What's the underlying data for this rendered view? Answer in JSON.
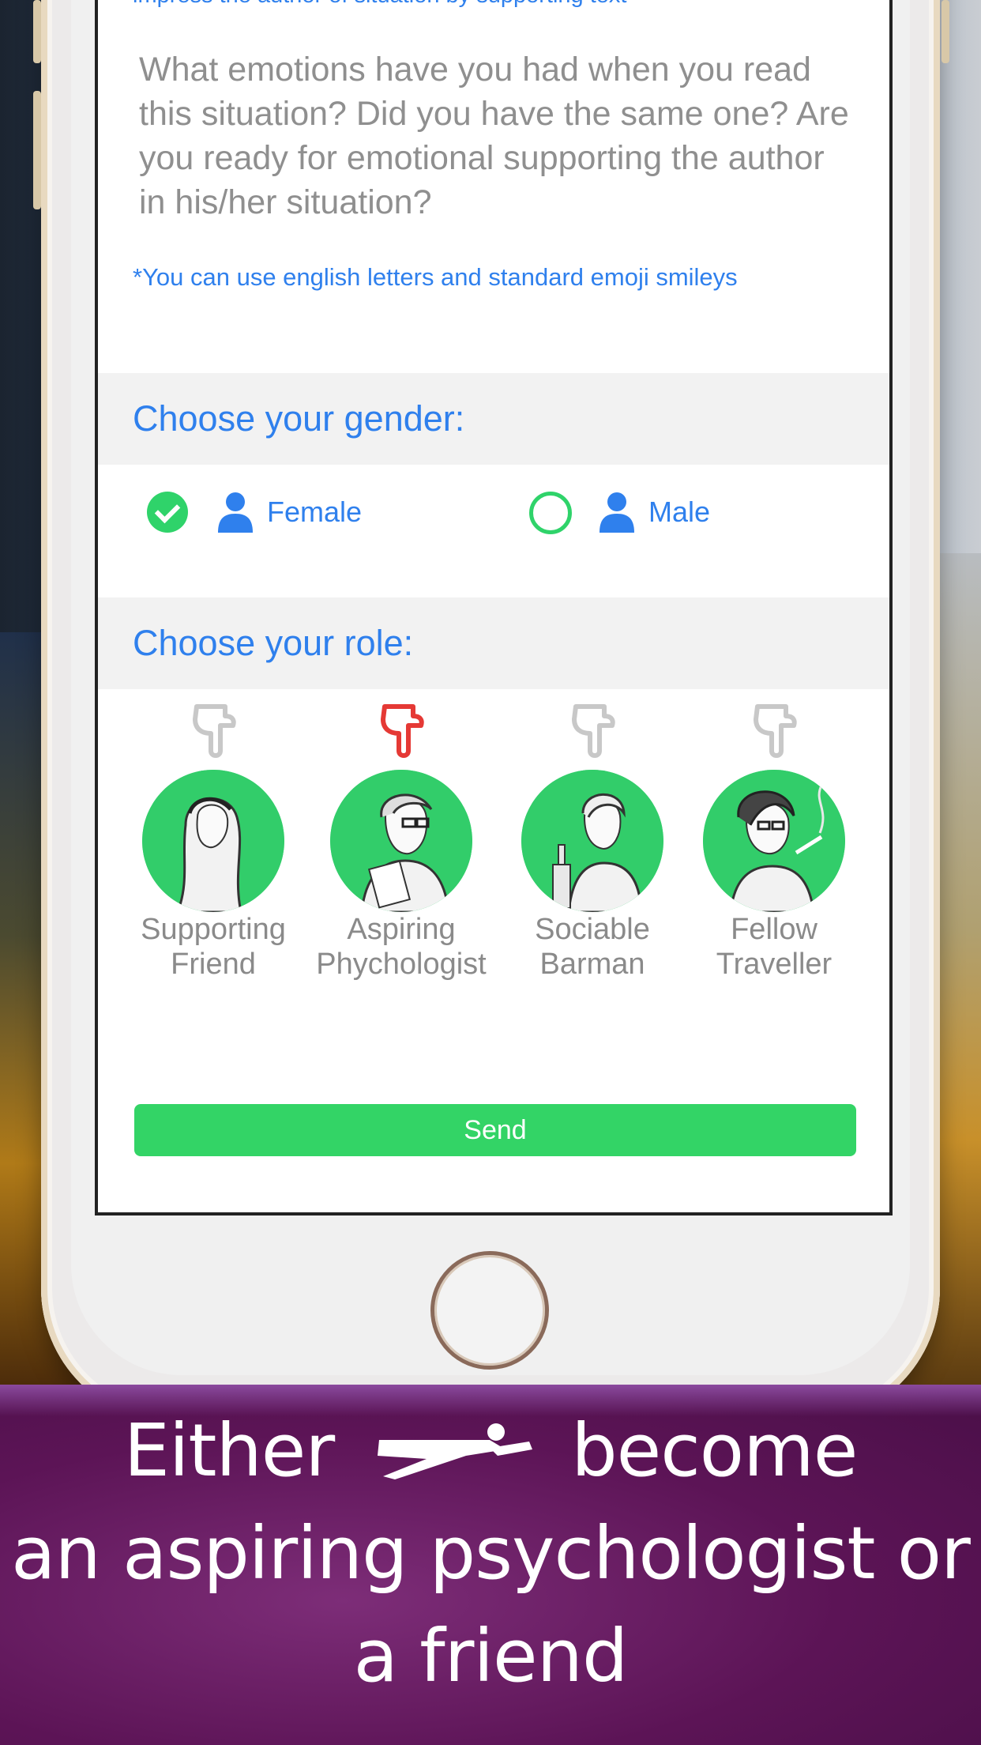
{
  "screen": {
    "top_hint": "impress the author of situation by supporting text",
    "placeholder": "What emotions have you had when you read this situation? Did you have the same one? Are you ready for emotional supporting the author in his/her situation?",
    "note": "*You can use english letters and standard emoji smileys",
    "gender_section": {
      "title": "Choose your gender:",
      "options": [
        {
          "label": "Female",
          "selected": true
        },
        {
          "label": "Male",
          "selected": false
        }
      ]
    },
    "role_section": {
      "title": "Choose your role:",
      "roles": [
        {
          "line1": "Supporting",
          "line2": "Friend",
          "selected": false
        },
        {
          "line1": "Aspiring",
          "line2": "Phychologist",
          "selected": true
        },
        {
          "line1": "Sociable",
          "line2": "Barman",
          "selected": false
        },
        {
          "line1": "Fellow",
          "line2": "Traveller",
          "selected": false
        }
      ]
    },
    "send_label": "Send"
  },
  "banner": {
    "line1_left": "Either",
    "line1_right": "become",
    "line2": "an aspiring psychologist or",
    "line3": "a friend",
    "icon": "paper-plane-icon"
  },
  "colors": {
    "accent_blue": "#2f80ed",
    "green": "#33d466",
    "selected_red": "#e53935",
    "banner_purple": "#5c1456"
  }
}
